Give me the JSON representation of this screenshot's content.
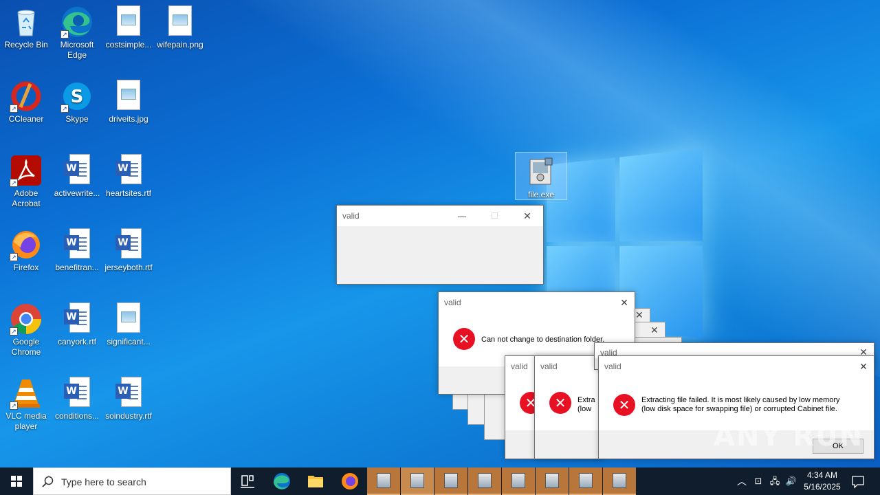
{
  "desktop": {
    "icons": {
      "recycle_bin": "Recycle Bin",
      "edge": "Microsoft Edge",
      "costsimple": "costsimple...",
      "wifepain": "wifepain.png",
      "ccleaner": "CCleaner",
      "skype": "Skype",
      "driveits": "driveits.jpg",
      "acrobat": "Adobe Acrobat",
      "activewrite": "activewrite...",
      "heartsites": "heartsites.rtf",
      "firefox": "Firefox",
      "benefitran": "benefitran...",
      "jerseyboth": "jerseyboth.rtf",
      "chrome": "Google Chrome",
      "canyork": "canyork.rtf",
      "significant": "significant...",
      "vlc": "VLC media player",
      "conditions": "conditions...",
      "soindustry": "soindustry.rtf",
      "file_exe": "file.exe"
    }
  },
  "dialogs": {
    "empty_window": {
      "title": "valid",
      "min": "—",
      "max": "☐",
      "close": "✕"
    },
    "folder_error": {
      "title": "valid",
      "close": "✕",
      "message": "Can not change to destination folder."
    },
    "stack_a": {
      "title": "valid"
    },
    "stack_b": {
      "title": "valid",
      "message_partial": "Extra\n(low"
    },
    "back_dialog": {
      "title": "valid",
      "close": "✕"
    },
    "extract_error": {
      "title": "valid",
      "close": "✕",
      "message_line1": "Extracting file failed.  It is most likely caused by low memory",
      "message_line2": "(low disk space for swapping file) or corrupted Cabinet file.",
      "ok": "OK"
    }
  },
  "watermark": "ANY RUN",
  "taskbar": {
    "search_placeholder": "Type here to search",
    "time": "4:34 AM",
    "date": "5/16/2025"
  }
}
